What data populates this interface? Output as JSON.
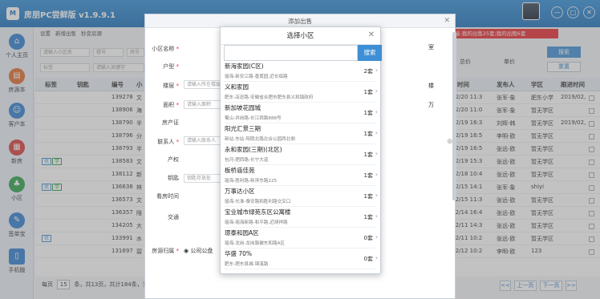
{
  "app": {
    "title": "房朋PC尝鲜版 v1.9.9.1",
    "logo": "M",
    "banner": "接-我的出售25套;我的出租6套",
    "window_buttons": [
      "—",
      "□",
      "✕"
    ]
  },
  "sidebar": [
    {
      "label": "个人主页",
      "icon": "home-icon",
      "glyph": "⌂",
      "color": "#2e7fd1"
    },
    {
      "label": "房源本",
      "icon": "house-book-icon",
      "glyph": "▤",
      "color": "#e06a2b"
    },
    {
      "label": "客户本",
      "icon": "client-book-icon",
      "glyph": "☺",
      "color": "#2e7fd1"
    },
    {
      "label": "新房",
      "icon": "new-house-icon",
      "glyph": "▦",
      "color": "#d73a3a"
    },
    {
      "label": "小区",
      "icon": "community-icon",
      "glyph": "♣",
      "color": "#2aa04a"
    },
    {
      "label": "签单宝",
      "icon": "sign-icon",
      "glyph": "✎",
      "color": "#2e7fd1"
    },
    {
      "label": "手机版",
      "icon": "phone-icon",
      "glyph": "▯",
      "color": "#2e7fd1"
    }
  ],
  "toolbar": {
    "settings": "设置",
    "add": "新增出售",
    "refresh": "秒变房源"
  },
  "filters": {
    "community_ph": "请输入小区名",
    "floor_ph": "楼号",
    "room_ph": "房号",
    "tag": "标签",
    "keyword_ph": "请输入关键字",
    "total_price": "总价",
    "unit_price": "单价",
    "search": "搜索",
    "reset": "重置",
    "room": "房号",
    "yuan": "元"
  },
  "grid": {
    "headers": [
      "标签",
      "钥匙",
      "编号",
      "小",
      "时间",
      "发布人",
      "学区",
      "跟进时间"
    ],
    "rows": [
      {
        "tags": [],
        "id": "139278",
        "c": "文",
        "time": "19/02/20 11:3",
        "pub": "张军-象",
        "school": "肥东小学",
        "follow": "2019/02,"
      },
      {
        "tags": [],
        "id": "138906",
        "c": "海",
        "time": "19/02/20 11:0",
        "pub": "张军-象",
        "school": "暂无学区",
        "follow": ""
      },
      {
        "tags": [],
        "id": "138790",
        "c": "半",
        "time": "19/02/19 16:3",
        "pub": "刘辉-韩",
        "school": "暂无学区",
        "follow": "2019/02,"
      },
      {
        "tags": [],
        "id": "138796",
        "c": "分",
        "time": "19/02/19 16:5",
        "pub": "李明-欧",
        "school": "暂无学区",
        "follow": ""
      },
      {
        "tags": [],
        "id": "138793",
        "c": "半",
        "time": "19/02/19 16:5",
        "pub": "张远-欧",
        "school": "暂无学区",
        "follow": ""
      },
      {
        "tags": [
          "优",
          "学"
        ],
        "id": "138583",
        "c": "文",
        "time": "19/02/19 15:3",
        "pub": "张远-欧",
        "school": "暂无学区",
        "follow": ""
      },
      {
        "tags": [],
        "id": "138112",
        "c": "新",
        "time": "19/02/18 10:4",
        "pub": "张远-欧",
        "school": "暂无学区",
        "follow": ""
      },
      {
        "tags": [
          "优",
          "学"
        ],
        "id": "136638",
        "c": "林",
        "time": "19/02/15 14:1",
        "pub": "张军-象",
        "school": "shiyi",
        "follow": ""
      },
      {
        "tags": [],
        "id": "136573",
        "c": "文",
        "time": "19/02/15 11:3",
        "pub": "张远-欧",
        "school": "暂无学区",
        "follow": ""
      },
      {
        "tags": [],
        "id": "136357",
        "c": "陪",
        "time": "19/02/14 16:4",
        "pub": "张远-欧",
        "school": "暂无学区",
        "follow": ""
      },
      {
        "tags": [],
        "id": "134205",
        "c": "大",
        "time": "19/02/11 14:3",
        "pub": "张远-欧",
        "school": "暂无学区",
        "follow": ""
      },
      {
        "tags": [
          "优"
        ],
        "id": "133991",
        "c": "水",
        "time": "19/02/11 10:2",
        "pub": "张远-欧",
        "school": "暂无学区",
        "follow": ""
      },
      {
        "tags": [],
        "id": "131697",
        "c": "碧",
        "time": "19/02/12 10:2",
        "pub": "李明-欧",
        "school": "123",
        "follow": ""
      }
    ]
  },
  "footer": {
    "per_page_label": "每页",
    "per_page": "15",
    "summary": "条，共13页，共计184条，当",
    "prev": "上一页",
    "next": "下一页",
    "first": "<<",
    "last": ">>"
  },
  "add_dialog": {
    "title": "添加出售",
    "labels": [
      "小区名称",
      "户型",
      "楼层",
      "面积",
      "房产证",
      "联系人",
      "产权",
      "钥匙",
      "看房时间",
      "交通",
      "房源归属"
    ],
    "floor_ph": "请输入所在楼层",
    "area_ph": "请输入面积",
    "contact_ph": "请输入联系人",
    "key_ph": "钥匙存放处",
    "owner_option": "公司公盘",
    "unit_m": "万",
    "unit_floor": "楼",
    "unit_room": "室"
  },
  "selector": {
    "title": "选择小区",
    "search_btn": "搜索",
    "items": [
      {
        "name": "新海家园(C区)",
        "addr": "瑶海-新安江路-香蕉园,近长临路",
        "count": "2套"
      },
      {
        "name": "义和家园",
        "addr": "肥东-店忠路-安徽省合肥市肥东县义和镇政府",
        "count": "1套"
      },
      {
        "name": "新加坡花园城",
        "addr": "蜀山-井岗路-长江西路888号",
        "count": "1套"
      },
      {
        "name": "阳光汇景三期",
        "addr": "新站-东站-阳陵北路北合公园西北侧",
        "count": "1套"
      },
      {
        "name": "永和家园(三期)(北区)",
        "addr": "包河-肥西路-长宁大道",
        "count": "1套"
      },
      {
        "name": "板桥庙佳苑",
        "addr": "瑶海-胜利路-新滨东路225",
        "count": "1套"
      },
      {
        "name": "万事达小区",
        "addr": "瑶海-长淮-泰安路和胜利路交叉口",
        "count": "1套"
      },
      {
        "name": "宝业城市绿苑东区公寓楼",
        "addr": "瑶海-瑶海新路-和平路,近胡祥路",
        "count": "1套"
      },
      {
        "name": "璟泰和园A区",
        "addr": "瑶海-龙岗-龙岗路徽东和路A区",
        "count": "0套"
      },
      {
        "name": "华盛 70%",
        "addr": "肥东-肥东县城-锦溪路",
        "count": "0套"
      }
    ]
  }
}
